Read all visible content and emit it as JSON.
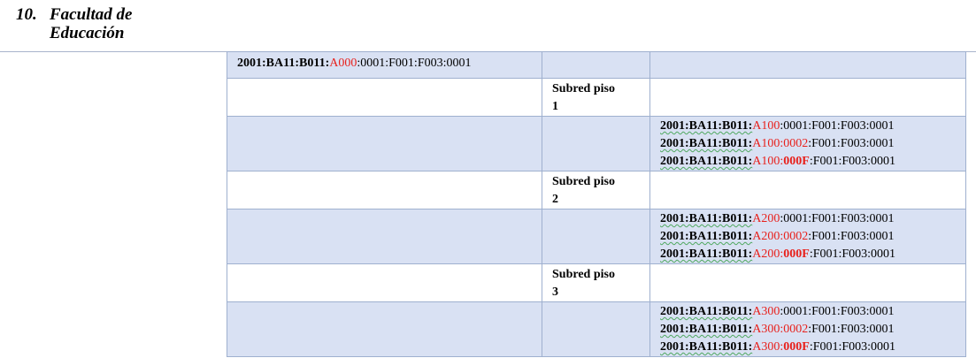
{
  "heading": {
    "number": "10.",
    "line1": "Facultad de",
    "line2": "Educación"
  },
  "table": {
    "top_address": {
      "prefix": "2001:BA11:B011:",
      "highlight": "A000",
      "suffix": ":0001:F001:F003:0001"
    },
    "subnets": [
      {
        "label_line1": "Subred piso",
        "label_line2": "1",
        "addresses": [
          {
            "prefix": "2001:BA11:B011:",
            "block": "A100",
            "host": ":0001",
            "suffix": ":F001:F003:0001"
          },
          {
            "prefix": "2001:BA11:B011:",
            "block": "A100",
            "host": ":0002",
            "suffix": ":F001:F003:0001"
          },
          {
            "prefix": "2001:BA11:B011:",
            "block": "A100",
            "host_sep": ":",
            "host": "000F",
            "suffix": ":F001:F003:0001"
          }
        ]
      },
      {
        "label_line1": "Subred piso",
        "label_line2": "2",
        "addresses": [
          {
            "prefix": "2001:BA11:B011:",
            "block": "A200",
            "host": ":0001",
            "suffix": ":F001:F003:0001"
          },
          {
            "prefix": "2001:BA11:B011:",
            "block": "A200",
            "host": ":0002",
            "suffix": ":F001:F003:0001"
          },
          {
            "prefix": "2001:BA11:B011:",
            "block": "A200",
            "host_sep": ":",
            "host": "000F",
            "suffix": ":F001:F003:0001"
          }
        ]
      },
      {
        "label_line1": "Subred piso",
        "label_line2": "3",
        "addresses": [
          {
            "prefix": "2001:BA11:B011:",
            "block": "A300",
            "host": ":0001",
            "suffix": ":F001:F003:0001"
          },
          {
            "prefix": "2001:BA11:B011:",
            "block": "A300",
            "host": ":0002",
            "suffix": ":F001:F003:0001"
          },
          {
            "prefix": "2001:BA11:B011:",
            "block": "A300",
            "host_sep": ":",
            "host": "000F",
            "suffix": ":F001:F003:0001"
          }
        ]
      }
    ]
  }
}
